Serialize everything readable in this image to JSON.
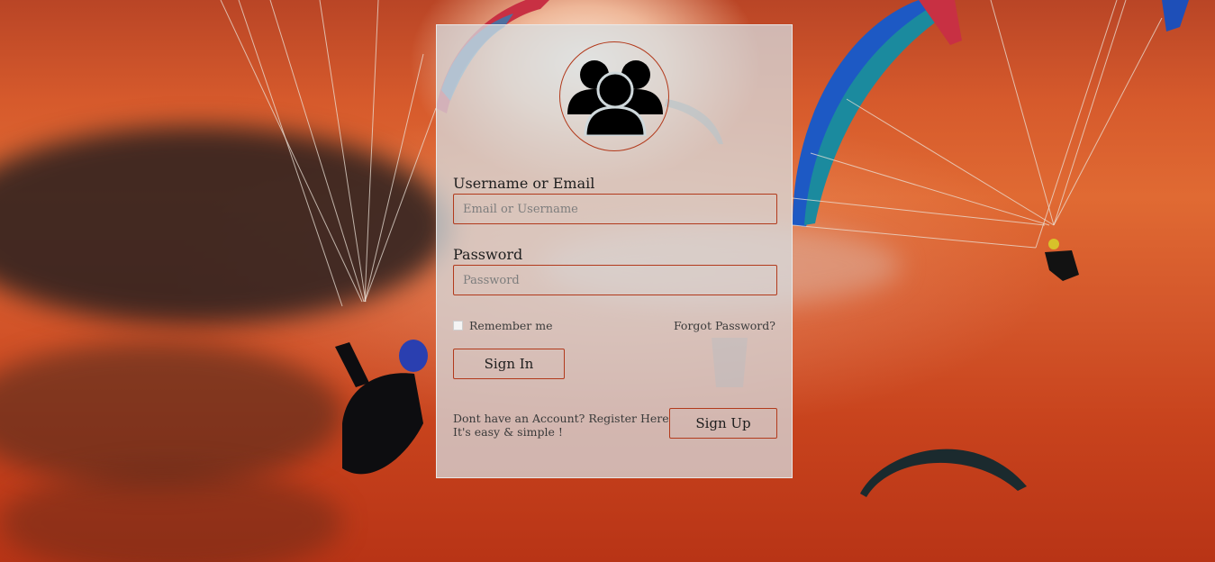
{
  "login": {
    "username_label": "Username or Email",
    "username_placeholder": "Email or Username",
    "password_label": "Password",
    "password_placeholder": "Password",
    "remember_label": "Remember me",
    "forgot_label": "Forgot Password?",
    "signin_label": "Sign In",
    "register_line1": "Dont have an Account? Register Here",
    "register_line2": "It's easy & simple !",
    "signup_label": "Sign Up",
    "avatar_icon": "users-icon"
  },
  "colors": {
    "accent": "#b23a1c",
    "card_bg": "#d6dfe2",
    "text": "#1e1e1e"
  }
}
